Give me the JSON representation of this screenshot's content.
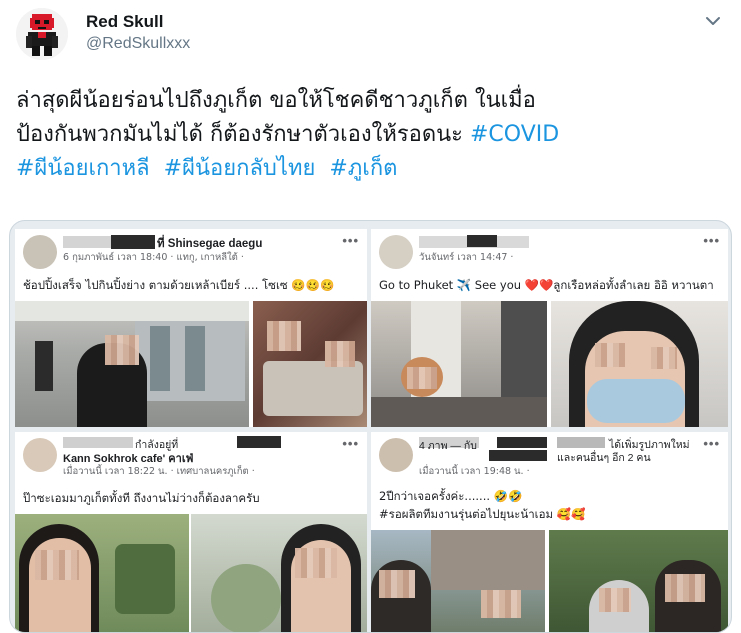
{
  "author": {
    "display_name": "Red Skull",
    "handle": "@RedSkullxxx"
  },
  "tweet": {
    "line1": "ล่าสุดผีน้อยร่อนไปถึงภูเก็ต ขอให้โชคดีชาวภูเก็ต ในเมื่อ",
    "line2_text": "ป้องกันพวกมันไม่ได้ ก็ต้องรักษาตัวเองให้รอดนะ ",
    "hashtags": [
      "#COVID",
      "#ผีน้อยเกาหลี",
      "#ผีน้อยกลับไทย",
      "#ภูเก็ต"
    ]
  },
  "posts": [
    {
      "name": "ที่ Shinsegae daegu",
      "sub": "6 กุมภาพันธ์ เวลา 18:40 · แทกู, เกาหลีใต้ · ",
      "text": "ช้อปปิ้งเสร็จ ไปกินปิ้งย่าง ตามด้วยเหล้าเบียร์ .... โซเซ 🥴🥴🥴",
      "menu": "•••"
    },
    {
      "name": "",
      "sub": "วันจันทร์ เวลา 14:47 · ",
      "text": "Go to Phuket ✈️ See you ❤️❤️ลูกเรือหล่อทั้งลำเลย อิอิ หวานตา",
      "menu": "•••"
    },
    {
      "name": "กำลังอยู่ที่",
      "name2": "Kann Sokhrok cafe' คาเฟ่",
      "sub": "เมื่อวานนี้ เวลา 18:22 น. · เทศบาลนครภูเก็ต · ",
      "text": "ป๊าซะเอมมาภูเก็ตทั้งที ถึงงานไม่ว่างก็ต้องลาครับ",
      "menu": "•••"
    },
    {
      "name": "4 ภาพ — กับ",
      "name_right": "ได้เพิ่มรูปภาพใหม่",
      "name2": "และคนอื่นๆ อีก 2 คน",
      "sub": "เมื่อวานนี้ เวลา 19:48 น. · ",
      "text": "2ปีกว่าเจอครั้งค่ะ....... 🤣🤣",
      "text2": "#รอผลิตทีมงานรุ่นต่อไปยุนะน้าเอม 🥰🥰",
      "menu": "•••"
    }
  ],
  "colors": {
    "hashtag": "#1b95e0",
    "handle": "#657786",
    "border": "#ccd6dd"
  },
  "icons": {
    "menu": "chevron-down-icon",
    "avatar": "red-skull-pixel-avatar"
  }
}
